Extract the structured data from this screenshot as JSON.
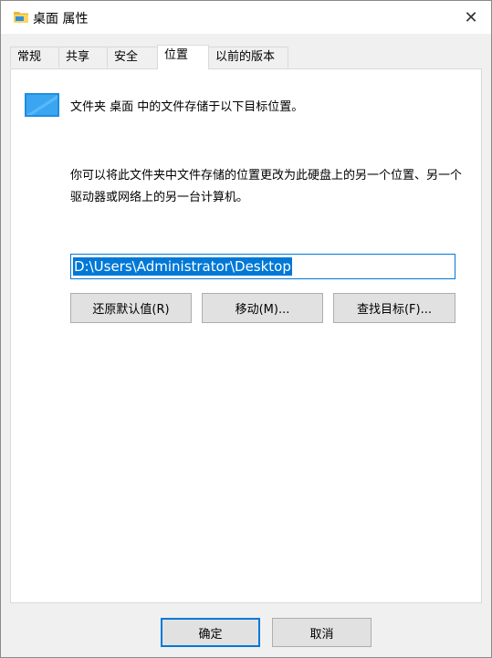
{
  "window": {
    "title": "桌面 属性"
  },
  "tabs": [
    {
      "label": "常规"
    },
    {
      "label": "共享"
    },
    {
      "label": "安全"
    },
    {
      "label": "位置"
    },
    {
      "label": "以前的版本"
    }
  ],
  "location": {
    "description": "文件夹 桌面 中的文件存储于以下目标位置。",
    "info": "你可以将此文件夹中文件存储的位置更改为此硬盘上的另一个位置、另一个驱动器或网络上的另一台计算机。",
    "path": "D:\\Users\\Administrator\\Desktop",
    "restore_default_label": "还原默认值(R)",
    "move_label": "移动(M)...",
    "find_target_label": "查找目标(F)..."
  },
  "footer": {
    "ok_label": "确定",
    "cancel_label": "取消"
  },
  "colors": {
    "accent": "#0078d7",
    "button_face": "#e1e1e1"
  }
}
